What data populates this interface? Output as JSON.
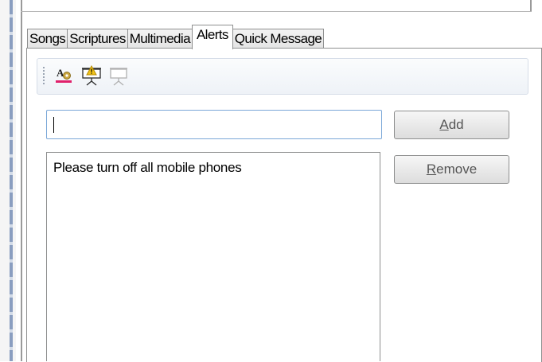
{
  "tabs": [
    {
      "label": "Songs",
      "active": false
    },
    {
      "label": "Scriptures",
      "active": false
    },
    {
      "label": "Multimedia",
      "active": false
    },
    {
      "label": "Alerts",
      "active": true
    },
    {
      "label": "Quick Message",
      "active": false
    }
  ],
  "toolbar": {
    "icons": [
      "font-settings-icon",
      "projector-alert-icon",
      "projector-off-icon"
    ]
  },
  "alert_input": {
    "value": "",
    "placeholder": ""
  },
  "buttons": {
    "add": {
      "mnemonic": "A",
      "rest": "dd"
    },
    "remove": {
      "mnemonic": "R",
      "rest": "emove"
    }
  },
  "alerts_list": [
    "Please turn off all mobile phones"
  ],
  "colors": {
    "input_border": "#7aa7d8",
    "warning_accent": "#f2c318",
    "font_underline": "#e0206a"
  }
}
